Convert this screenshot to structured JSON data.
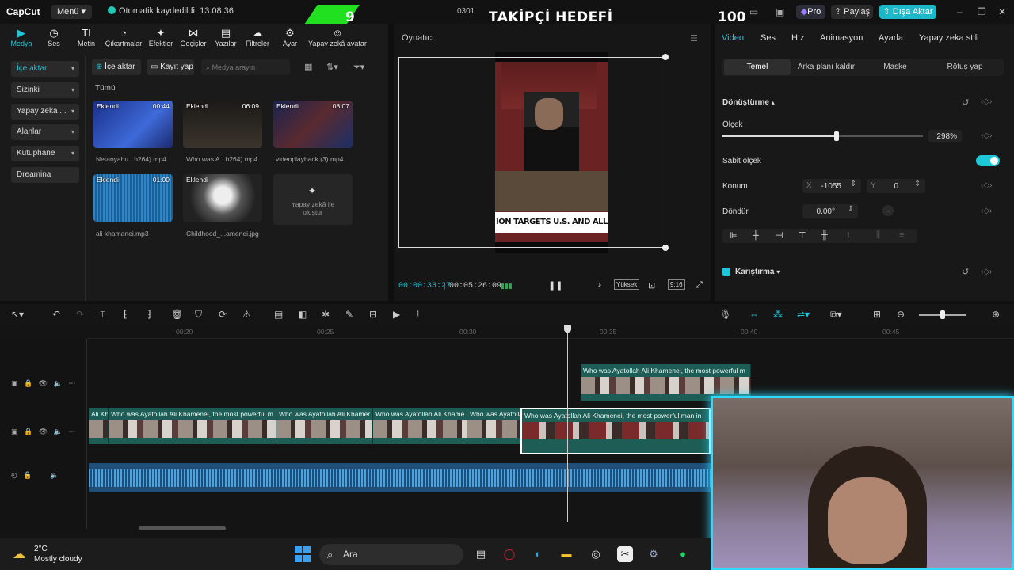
{
  "app": {
    "logo": "CapCut",
    "menu": "Menü",
    "autosave": "Otomatik kaydedildi: 13:08:36",
    "project_code": "0301"
  },
  "overlay": {
    "left_number": "9",
    "title": "TAKİPÇİ HEDEFİ",
    "goal": "100"
  },
  "header_buttons": {
    "pro": "Pro",
    "share": "Paylaş",
    "export": "Dışa Aktar"
  },
  "tools": [
    "Medya",
    "Ses",
    "Metin",
    "Çıkartmalar",
    "Efektler",
    "Geçişler",
    "Yazılar",
    "Filtreler",
    "Ayar",
    "Yapay zekâ avatar"
  ],
  "side_nav": [
    "İçe aktar",
    "Sizinki",
    "Yapay zeka ...",
    "Alanlar",
    "Kütüphane",
    "Dreamina"
  ],
  "media_toolbar": {
    "import": "İçe aktar",
    "record": "Kayıt yap",
    "search_placeholder": "Medya arayın"
  },
  "media": {
    "all_label": "Tümü",
    "items": [
      {
        "tag": "Eklendi",
        "duration": "00:44",
        "name": "Netanyahu...h264).mp4"
      },
      {
        "tag": "Eklendi",
        "duration": "06:09",
        "name": "Who was A...h264).mp4"
      },
      {
        "tag": "Eklendi",
        "duration": "08:07",
        "name": "videoplayback (3).mp4"
      },
      {
        "tag": "Eklendi",
        "duration": "01:00",
        "name": "ali khamanei.mp3"
      },
      {
        "tag": "Eklendi",
        "duration": "",
        "name": "Childhood_...amenei.jpg"
      }
    ],
    "ai_create": "Yapay zekâ ile oluştur"
  },
  "player": {
    "title": "Oynatıcı",
    "caption": "ION TARGETS U.S. AND ALL",
    "time_current": "00:00:33:27",
    "time_total": "00:05:26:09",
    "quality": "Yüksek",
    "ratio": "9:16"
  },
  "right_tabs": [
    "Video",
    "Ses",
    "Hız",
    "Animasyon",
    "Ayarla",
    "Yapay zeka stili"
  ],
  "right_subtabs": [
    "Temel",
    "Arka planı kaldır",
    "Maske",
    "Rötuş yap"
  ],
  "properties": {
    "transform": "Dönüştürme",
    "scale_label": "Ölçek",
    "scale_value": "298%",
    "scale_fraction": 0.57,
    "uniform_scale": "Sabit ölçek",
    "position_label": "Konum",
    "pos_x_label": "X",
    "pos_x": "-1055",
    "pos_y_label": "Y",
    "pos_y": "0",
    "rotate_label": "Döndür",
    "rotate_value": "0.00°",
    "blend": "Karıştırma"
  },
  "timeline": {
    "ticks": [
      "00:20",
      "00:25",
      "00:30",
      "00:35",
      "00:40",
      "00:45"
    ],
    "overlay_clip": "Who was Ayatollah Ali Khamenei, the most powerful m",
    "main_clips": [
      "Ali Kha",
      "Who was Ayatollah Ali Khamenei, the most powerful m",
      "Who was Ayatollah Ali Khamer",
      "Who was Ayatollah Ali Khame",
      "Who was Ayatolla",
      "Who was Ayatollah Ali Khamenei, the most powerful man in"
    ]
  },
  "taskbar": {
    "temp": "2°C",
    "weather": "Mostly cloudy",
    "search": "Ara"
  },
  "colors": {
    "accent": "#1fc8d8",
    "export": "#1ab8c8",
    "banner": "#20e020",
    "webcam_border": "#2fd8ff"
  }
}
